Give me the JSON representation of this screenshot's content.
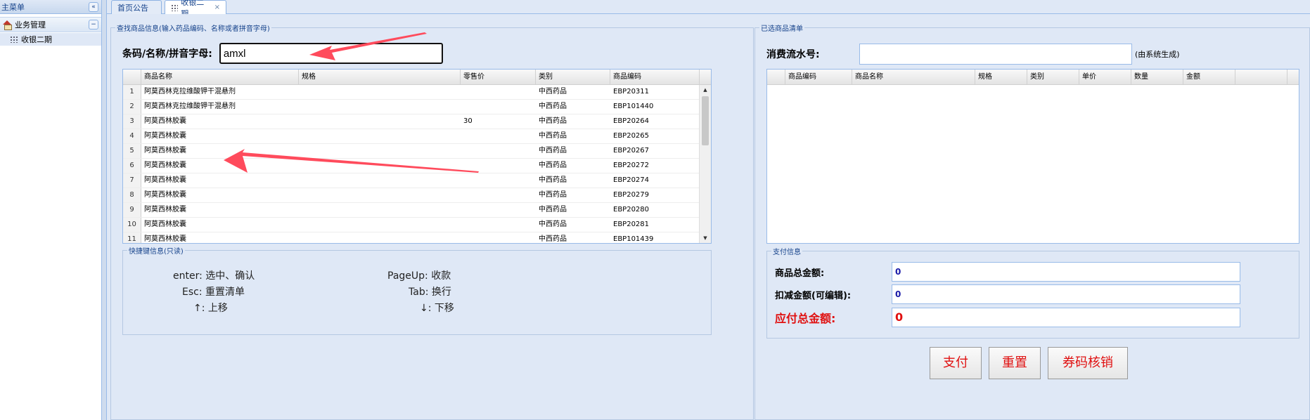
{
  "sidebar": {
    "title": "主菜单",
    "collapse_icon": "«",
    "group_label": "业务管理",
    "group_toggle": "−",
    "item_label": "收银二期"
  },
  "tabs": [
    {
      "label": "首页公告"
    },
    {
      "label": "收银二期",
      "close": "×"
    }
  ],
  "search_panel": {
    "legend": "查找商品信息(输入药品编码、名称或者拼音字母)",
    "label": "条码/名称/拼音字母:",
    "value": "amxl"
  },
  "product_grid": {
    "columns": [
      "商品名称",
      "规格",
      "零售价",
      "类别",
      "商品编码"
    ],
    "rows": [
      {
        "n": "1",
        "name": "阿莫西林克拉维酸钾干混悬剂",
        "spec": "",
        "price": "",
        "cat": "中西药品",
        "code": "EBP20311"
      },
      {
        "n": "2",
        "name": "阿莫西林克拉维酸钾干混悬剂",
        "spec": "",
        "price": "",
        "cat": "中西药品",
        "code": "EBP101440"
      },
      {
        "n": "3",
        "name": "阿莫西林胶囊",
        "spec": "",
        "price": "30",
        "cat": "中西药品",
        "code": "EBP20264"
      },
      {
        "n": "4",
        "name": "阿莫西林胶囊",
        "spec": "",
        "price": "",
        "cat": "中西药品",
        "code": "EBP20265"
      },
      {
        "n": "5",
        "name": "阿莫西林胶囊",
        "spec": "",
        "price": "",
        "cat": "中西药品",
        "code": "EBP20267"
      },
      {
        "n": "6",
        "name": "阿莫西林胶囊",
        "spec": "",
        "price": "",
        "cat": "中西药品",
        "code": "EBP20272"
      },
      {
        "n": "7",
        "name": "阿莫西林胶囊",
        "spec": "",
        "price": "",
        "cat": "中西药品",
        "code": "EBP20274"
      },
      {
        "n": "8",
        "name": "阿莫西林胶囊",
        "spec": "",
        "price": "",
        "cat": "中西药品",
        "code": "EBP20279"
      },
      {
        "n": "9",
        "name": "阿莫西林胶囊",
        "spec": "",
        "price": "",
        "cat": "中西药品",
        "code": "EBP20280"
      },
      {
        "n": "10",
        "name": "阿莫西林胶囊",
        "spec": "",
        "price": "",
        "cat": "中西药品",
        "code": "EBP20281"
      },
      {
        "n": "11",
        "name": "阿莫西林胶囊",
        "spec": "",
        "price": "",
        "cat": "中西药品",
        "code": "EBP101439"
      }
    ]
  },
  "shortcuts": {
    "legend": "快捷键信息(只读)",
    "items": [
      "enter: 选中、确认",
      "Esc: 重置清单",
      "↑: 上移",
      "PageUp: 收款",
      "Tab: 换行",
      "↓: 下移"
    ]
  },
  "selected_panel": {
    "legend": "已选商品清单",
    "serial_label": "消费流水号:",
    "serial_value": "",
    "serial_hint": "(由系统生成)",
    "columns": [
      "商品编码",
      "商品名称",
      "规格",
      "类别",
      "单价",
      "数量",
      "金额"
    ]
  },
  "payment": {
    "legend": "支付信息",
    "total_label": "商品总金额:",
    "total_value": "0",
    "discount_label": "扣减金额(可编辑):",
    "discount_value": "0",
    "payable_label": "应付总金额:",
    "payable_value": "0"
  },
  "buttons": {
    "pay": "支付",
    "reset": "重置",
    "coupon": "券码核销"
  },
  "colors": {
    "panel_bg": "#dfe8f6",
    "border": "#99bbe8",
    "accent_red": "#e01010",
    "arrow": "#ff4b5c"
  }
}
